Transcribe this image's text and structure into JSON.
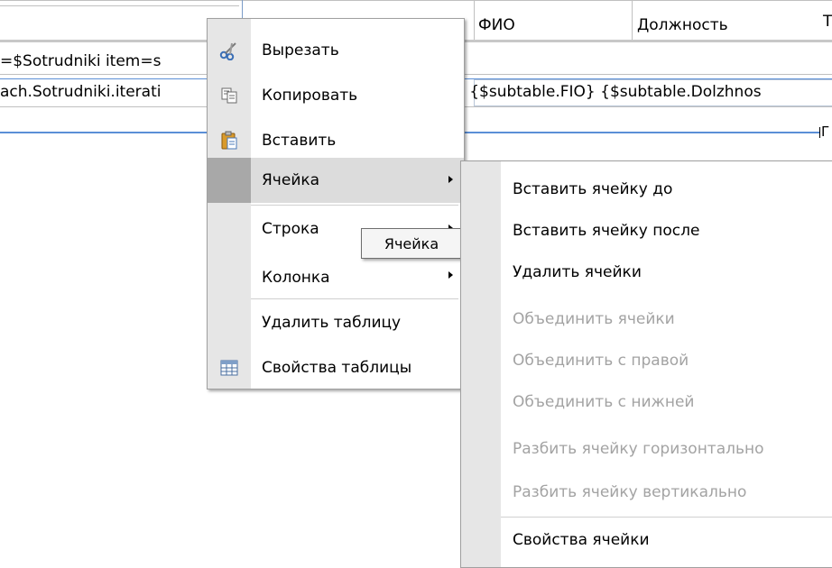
{
  "background": {
    "header_col_fio": "ФИО",
    "header_col_position": "Должность",
    "header_col_trailing": "Т",
    "row1_text": "=$Sotrudniki item=s",
    "row2_left": "ach.Sotrudniki.iterati",
    "row2_mid": "} {$subtable.FIO} {$subtable.Dolzhnos",
    "row3_trailing": "Г"
  },
  "context_menu": {
    "items": [
      {
        "label": "Вырезать",
        "icon": "scissors-icon"
      },
      {
        "label": "Копировать",
        "icon": "copy-icon"
      },
      {
        "label": "Вставить",
        "icon": "paste-icon"
      },
      {
        "label": "Ячейка",
        "has_submenu": true,
        "highlighted": true
      },
      {
        "label": "Строка",
        "has_submenu": true
      },
      {
        "label": "Колонка",
        "has_submenu": true
      },
      {
        "label": "Удалить таблицу"
      },
      {
        "label": "Свойства таблицы",
        "icon": "table-icon"
      }
    ]
  },
  "tooltip": "Ячейка",
  "submenu": {
    "items": [
      {
        "label": "Вставить ячейку до",
        "enabled": true
      },
      {
        "label": "Вставить ячейку после",
        "enabled": true
      },
      {
        "label": "Удалить ячейки",
        "enabled": true
      },
      {
        "label": "Объединить ячейки",
        "enabled": false
      },
      {
        "label": "Объединить с правой",
        "enabled": false
      },
      {
        "label": "Объединить с нижней",
        "enabled": false
      },
      {
        "label": "Разбить ячейку горизонтально",
        "enabled": false
      },
      {
        "label": "Разбить ячейку вертикально",
        "enabled": false
      },
      {
        "label": "Свойства ячейки",
        "enabled": true
      }
    ]
  },
  "colors": {
    "highlight": "#dcdcdc",
    "disabled_text": "#a3a3a3",
    "accent_line": "#5b8fd6"
  }
}
